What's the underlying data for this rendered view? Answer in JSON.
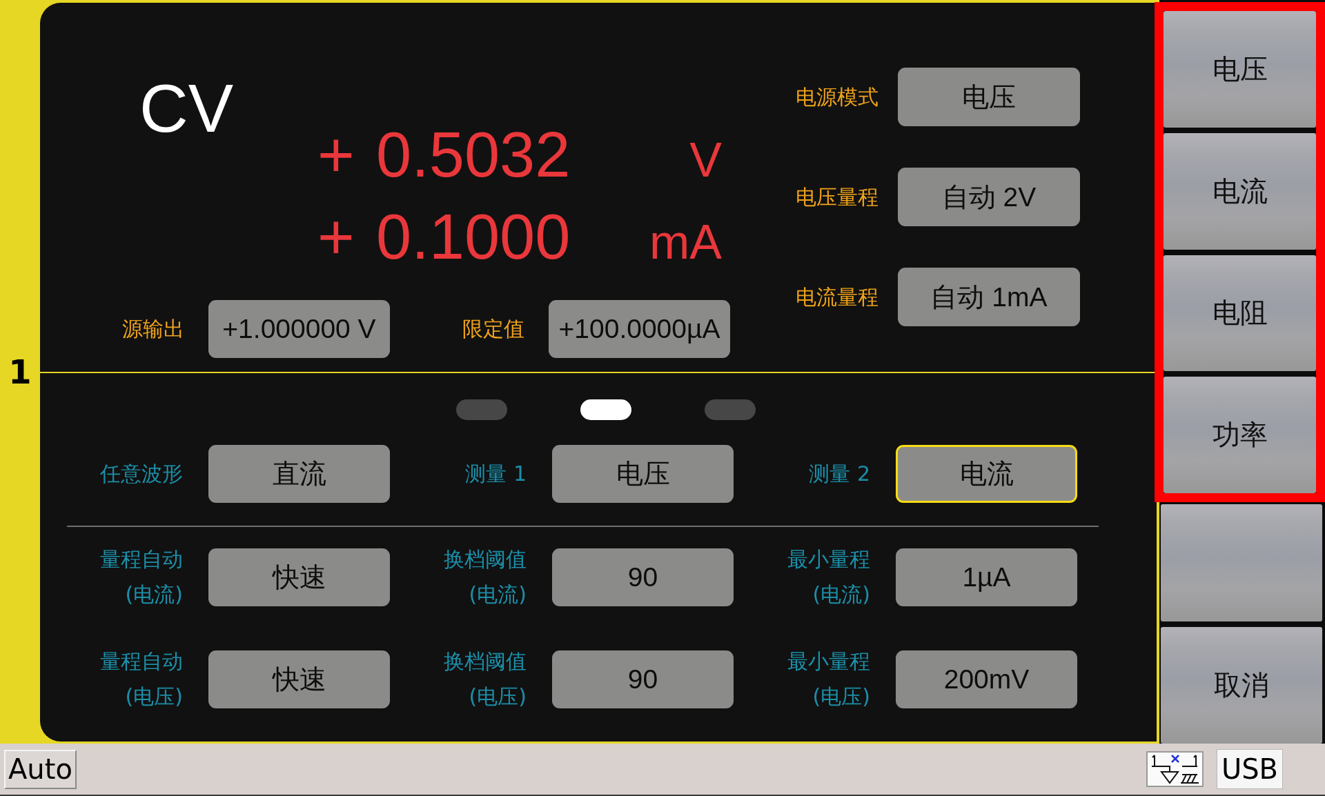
{
  "channel": {
    "number": "1"
  },
  "display": {
    "mode": "CV",
    "readings": [
      {
        "sign": "+",
        "value": "0.5032",
        "unit": "V"
      },
      {
        "sign": "+",
        "value": "0.1000",
        "unit": "mA"
      }
    ]
  },
  "source_settings": [
    {
      "label": "源输出",
      "value": "+1.000000 V",
      "focused": false
    },
    {
      "label": "限定值",
      "value": "+100.0000µA",
      "focused": false
    }
  ],
  "mode_settings": [
    {
      "label": "电源模式",
      "value": "电压",
      "focused": false
    },
    {
      "label": "电压量程",
      "value": "自动 2V",
      "focused": false
    },
    {
      "label": "电流量程",
      "value": "自动 1mA",
      "focused": false
    }
  ],
  "page_dots": [
    {
      "selected": false
    },
    {
      "selected": true
    },
    {
      "selected": false
    }
  ],
  "measure_settings": [
    {
      "label": "任意波形",
      "value": "直流",
      "focused": false
    },
    {
      "label": "测量 1",
      "value": "电压",
      "focused": false
    },
    {
      "label": "测量 2",
      "value": "电流",
      "focused": true
    }
  ],
  "range_rows": [
    {
      "items": [
        {
          "label": "量程自动",
          "qualifier": "(电流)",
          "value": "快速",
          "focused": false
        },
        {
          "label": "换档阈值",
          "qualifier": "(电流)",
          "value": "90",
          "focused": false
        },
        {
          "label": "最小量程",
          "qualifier": "(电流)",
          "value": "1µA",
          "focused": false
        }
      ]
    },
    {
      "items": [
        {
          "label": "量程自动",
          "qualifier": "(电压)",
          "value": "快速",
          "focused": false
        },
        {
          "label": "换档阈值",
          "qualifier": "(电压)",
          "value": "90",
          "focused": false
        },
        {
          "label": "最小量程",
          "qualifier": "(电压)",
          "value": "200mV",
          "focused": false
        }
      ]
    }
  ],
  "softkeys": [
    {
      "label": "电压",
      "highlighted": true
    },
    {
      "label": "电流",
      "highlighted": true
    },
    {
      "label": "电阻",
      "highlighted": true
    },
    {
      "label": "功率",
      "highlighted": true
    },
    {
      "highlighted": false
    },
    {
      "label": "取消",
      "highlighted": false
    }
  ],
  "status_bar": {
    "mode": "Auto",
    "connection": "USB"
  }
}
